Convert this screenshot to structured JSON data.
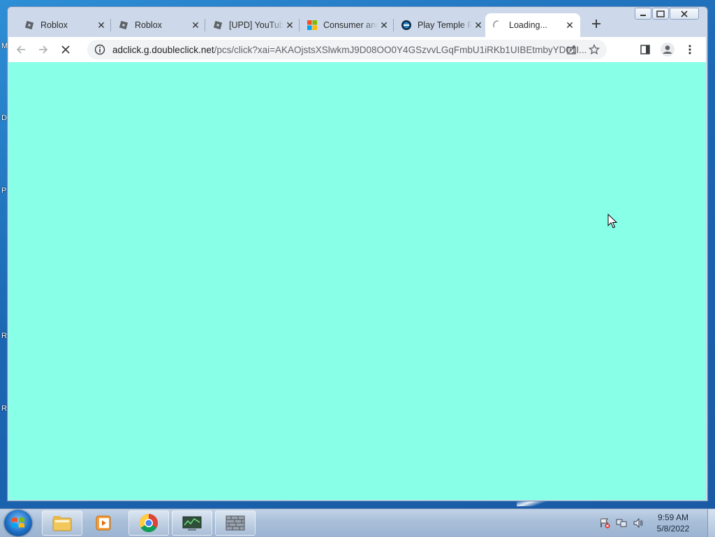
{
  "browser": {
    "tabs": [
      {
        "title": "Roblox",
        "favicon": "roblox-icon",
        "active": false
      },
      {
        "title": "Roblox",
        "favicon": "roblox-icon",
        "active": false
      },
      {
        "title": "[UPD] YouTube",
        "favicon": "roblox-icon",
        "active": false
      },
      {
        "title": "Consumer and",
        "favicon": "microsoft-icon",
        "active": false
      },
      {
        "title": "Play Temple Run",
        "favicon": "temple-icon",
        "active": false
      },
      {
        "title": "Loading...",
        "favicon": "spinner-icon",
        "active": true
      }
    ],
    "url_host": "adclick.g.doubleclick.net",
    "url_path": "/pcs/click?xai=AKAOjstsXSlwkmJ9D08OO0Y4GSzvvLGqFmbU1iRKb1UIBEtmbyYD01I...",
    "page_background": "#88ffe7"
  },
  "desktop": {
    "edge_letters": [
      "M",
      "D",
      "P",
      "R",
      "R"
    ]
  },
  "taskbar": {
    "time": "9:59 AM",
    "date": "5/8/2022"
  }
}
